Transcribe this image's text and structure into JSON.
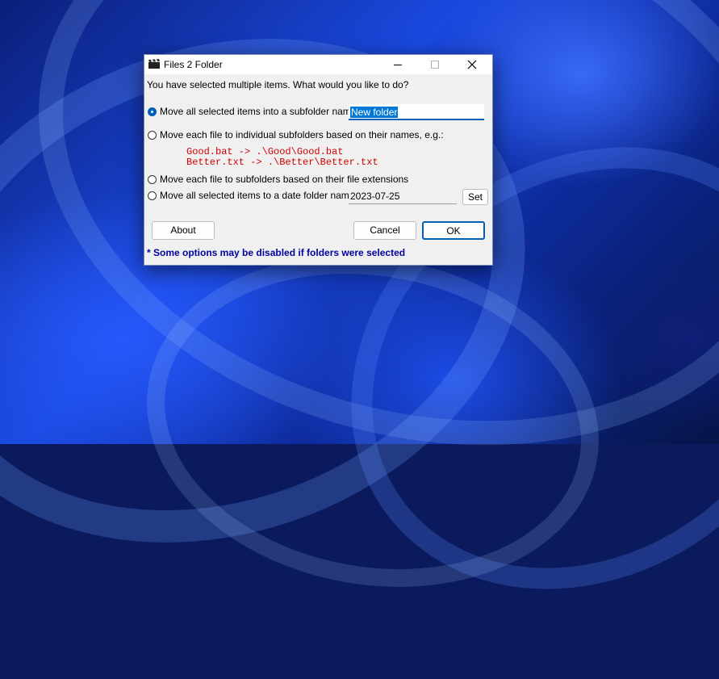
{
  "window": {
    "title": "Files 2 Folder",
    "prompt": "You have selected multiple items.  What would you like to do?"
  },
  "options": [
    {
      "label": "Move all selected items into a subfolder named:",
      "selected": true
    },
    {
      "label": "Move each file to individual subfolders based on their names, e.g.:",
      "selected": false
    },
    {
      "label": "Move each file to subfolders based on their file extensions",
      "selected": false
    },
    {
      "label": "Move all selected items to a date folder named:",
      "selected": false
    }
  ],
  "subfolder_name": {
    "value": "New folder"
  },
  "examples": [
    "Good.bat -> .\\Good\\Good.bat",
    "Better.txt -> .\\Better\\Better.txt"
  ],
  "date_folder": {
    "value": "2023-07-25"
  },
  "buttons": {
    "set": "Set",
    "about": "About",
    "cancel": "Cancel",
    "ok": "OK"
  },
  "footnote": "* Some options may be disabled if folders were selected",
  "colors": {
    "accent": "#005fb8",
    "example_text": "#d00000",
    "footnote_text": "#0000a0",
    "selection": "#0078d7"
  },
  "icons": {
    "app": "clapperboard-icon",
    "minimize": "minimize-icon",
    "maximize": "maximize-icon",
    "close": "close-icon"
  }
}
